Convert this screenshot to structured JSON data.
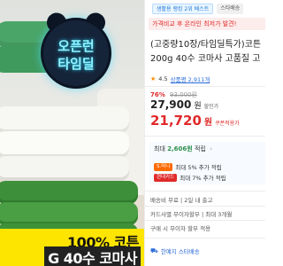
{
  "hero": {
    "clock_line1": "오픈런",
    "clock_line2": "타임딜",
    "promo_line1": "100% 코튼",
    "promo_line2": "G 40수 코마사"
  },
  "tags": {
    "best": "생활용 랭킹 2위 베스트",
    "star": "스타배송"
  },
  "alert": "가격비교 후 온라인 최저가 발견!",
  "product": {
    "title_line1": "(고중량10장/타임딜특가)코튼",
    "title_line2": "200g 40수 코마사 고품질 고"
  },
  "rating": {
    "score": "4.5",
    "count": "상품평 2,911개"
  },
  "price": {
    "discount_pct": "76%",
    "original": "93,000원",
    "sale": "27,900",
    "sale_unit": "원",
    "sale_suffix": "할인가",
    "coupon": "21,720",
    "coupon_unit": "원",
    "coupon_suffix": "쿠폰적용가"
  },
  "rewards": {
    "top_label": "최대",
    "top_amount": "2,606원",
    "top_suffix": "적립",
    "rows": [
      {
        "badge": "S.머니",
        "text": "최대 5% 추가 적립"
      },
      {
        "badge": "현대카드",
        "text": "최대 7% 추가 적립"
      }
    ]
  },
  "delivery": "배송비 무료 | 2일 내 출고",
  "shipping": "카드사별 무이자할부 | 최대 3개월",
  "installment": "구매 시 무이자 할부 적용",
  "ship_footer": "한예지 스타배송"
}
